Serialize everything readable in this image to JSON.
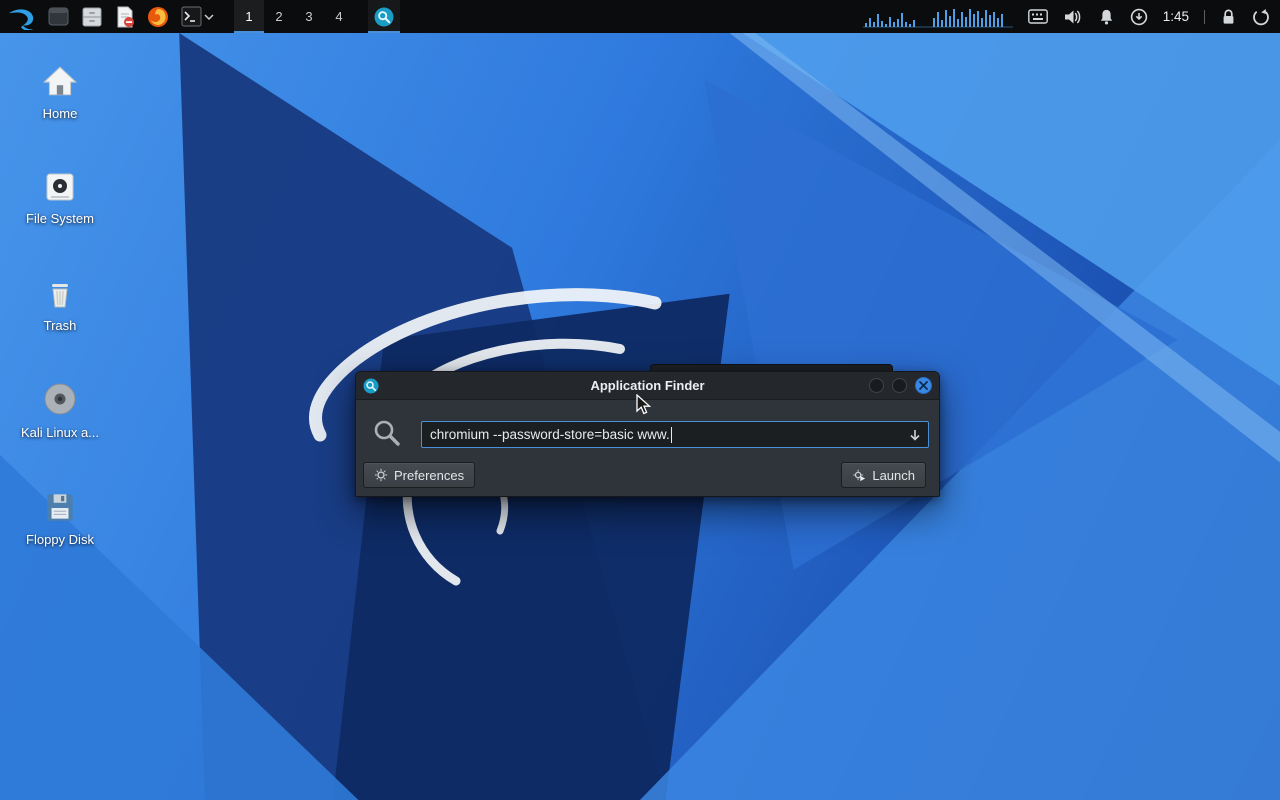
{
  "panel": {
    "workspaces": [
      "1",
      "2",
      "3",
      "4"
    ],
    "active_workspace": "1",
    "clock": "1:45"
  },
  "desktop": {
    "icons": [
      {
        "label": "Home"
      },
      {
        "label": "File System"
      },
      {
        "label": "Trash"
      },
      {
        "label": "Kali Linux a..."
      },
      {
        "label": "Floppy Disk"
      }
    ]
  },
  "finder": {
    "title": "Application Finder",
    "search": {
      "value": "chromium --password-store=basic www."
    },
    "preferences_label": "Preferences",
    "launch_label": "Launch"
  },
  "colors": {
    "accent": "#4a90d9",
    "close_button": "#3988e4",
    "panel_bg": "#0b0c0d",
    "window_bg": "#2f343a"
  },
  "icons": {
    "panel_left": [
      "kali-menu",
      "window",
      "file-manager",
      "text-editor",
      "firefox",
      "terminal",
      "terminal-dropdown",
      "app-finder"
    ],
    "panel_right": [
      "cpu-graph",
      "keyboard",
      "volume",
      "notifications-bell",
      "updates",
      "lock",
      "session-power"
    ],
    "finder": [
      "magnifier",
      "combo-down-arrow",
      "gear",
      "run-gear"
    ]
  }
}
